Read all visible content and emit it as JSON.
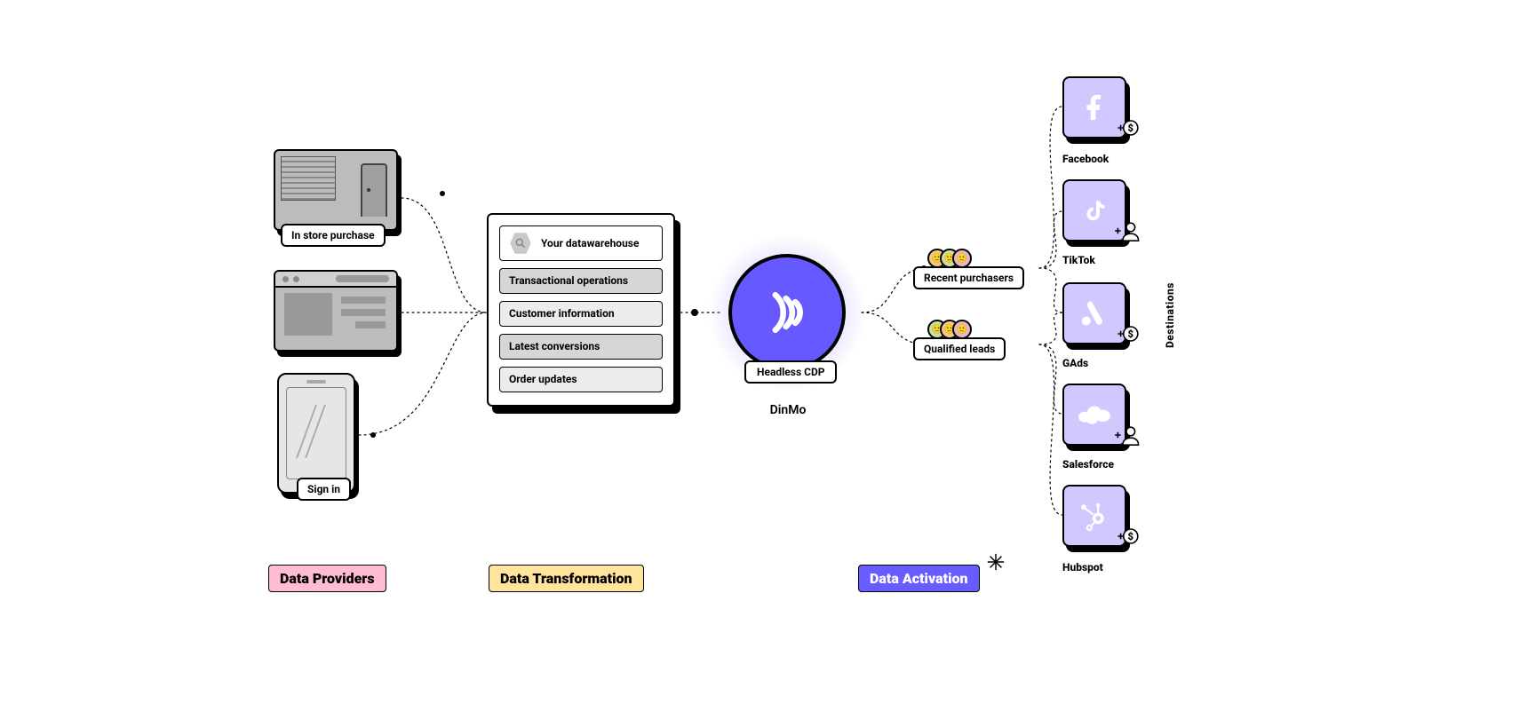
{
  "providers": [
    {
      "label": "In store purchase"
    },
    {
      "label": ""
    },
    {
      "label": "Sign in"
    }
  ],
  "warehouse": {
    "header": "Your datawarehouse",
    "rows": [
      "Transactional operations",
      "Customer information",
      "Latest conversions",
      "Order updates"
    ]
  },
  "cdp": {
    "label": "Headless CDP",
    "brand": "DinMo"
  },
  "segments": [
    {
      "label": "Recent purchasers"
    },
    {
      "label": "Qualified leads"
    }
  ],
  "destinations": [
    {
      "label": "Facebook",
      "badge": "money"
    },
    {
      "label": "TikTok",
      "badge": "person"
    },
    {
      "label": "GAds",
      "badge": "money"
    },
    {
      "label": "Salesforce",
      "badge": "person"
    },
    {
      "label": "Hubspot",
      "badge": "money"
    }
  ],
  "side_label": "Destinations",
  "sections": [
    "Data Providers",
    "Data Transformation",
    "Data Activation"
  ]
}
